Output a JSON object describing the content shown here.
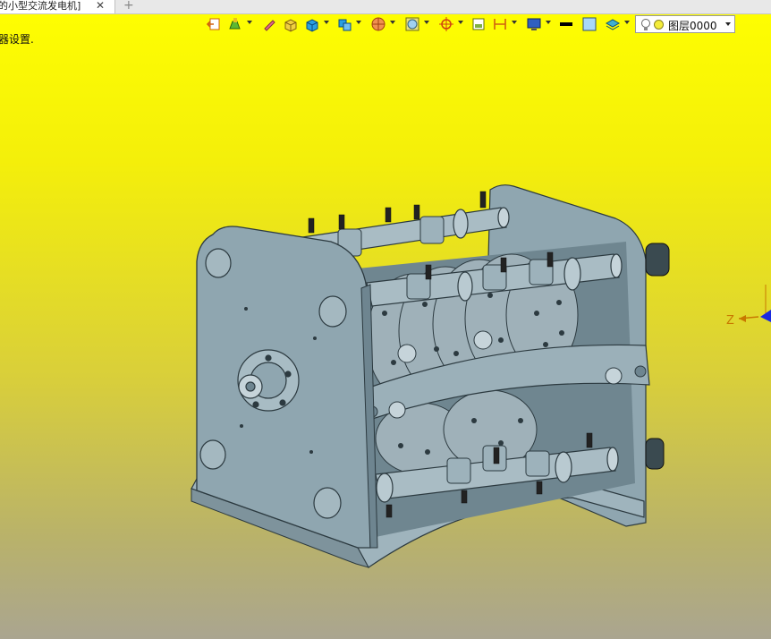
{
  "tab": {
    "title": "的小型交流发电机]",
    "close": "✕",
    "add": "+"
  },
  "status_text": "器设置.",
  "toolbar": {
    "icons": [
      "exit-icon",
      "paint-icon",
      "pencil-icon",
      "box-icon",
      "cube-icon",
      "shaded-cube-icon",
      "section-icon",
      "pie-view-icon",
      "render-icon",
      "snap-icon",
      "frame-icon",
      "measure-icon",
      "display-icon",
      "line-color-icon",
      "fill-color-icon",
      "layer-stack-icon"
    ],
    "layer_value": "图层0000"
  },
  "axis": {
    "label": "Z"
  },
  "colors": {
    "background_top": "#ffff00",
    "background_bottom": "#aaa590",
    "model": "#8fa6b0",
    "model_dark": "#6e8590",
    "model_light": "#b7c8cf"
  }
}
